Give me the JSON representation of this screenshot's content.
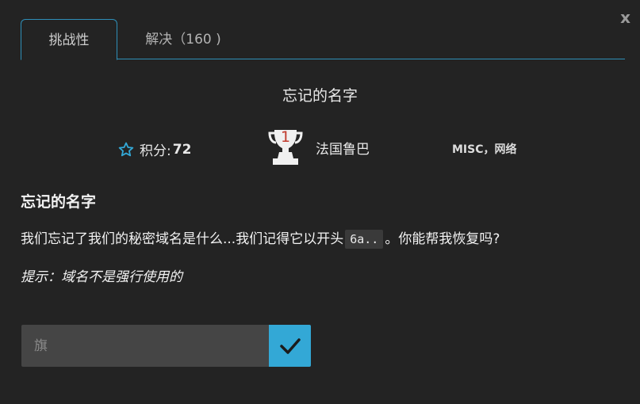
{
  "close_label": "x",
  "tabs": [
    {
      "label": "挑战性"
    },
    {
      "label": "解决（160 )"
    }
  ],
  "challenge": {
    "title": "忘记的名字",
    "points_label": "积分:",
    "points_value": "72",
    "first_blood_rank": "1",
    "first_blood_holder": "法国鲁巴",
    "tags": "MISC，网络",
    "description_heading": "忘记的名字",
    "description_before_code": "我们忘记了我们的秘密域名是什么...我们记得它以开头",
    "description_code": "6a..",
    "description_after_code": "。你能帮我恢复吗?",
    "hint": "提示：域名不是强行使用的"
  },
  "flag": {
    "placeholder": "旗",
    "value": ""
  },
  "icons": {
    "star": "star-outline-icon",
    "trophy": "trophy-icon",
    "submit": "checkmark-icon"
  },
  "colors": {
    "accent": "#33a8d6",
    "tab_border": "#2e8fb8",
    "background": "#232323",
    "input_background": "#454545",
    "rank_red": "#c0392b"
  }
}
